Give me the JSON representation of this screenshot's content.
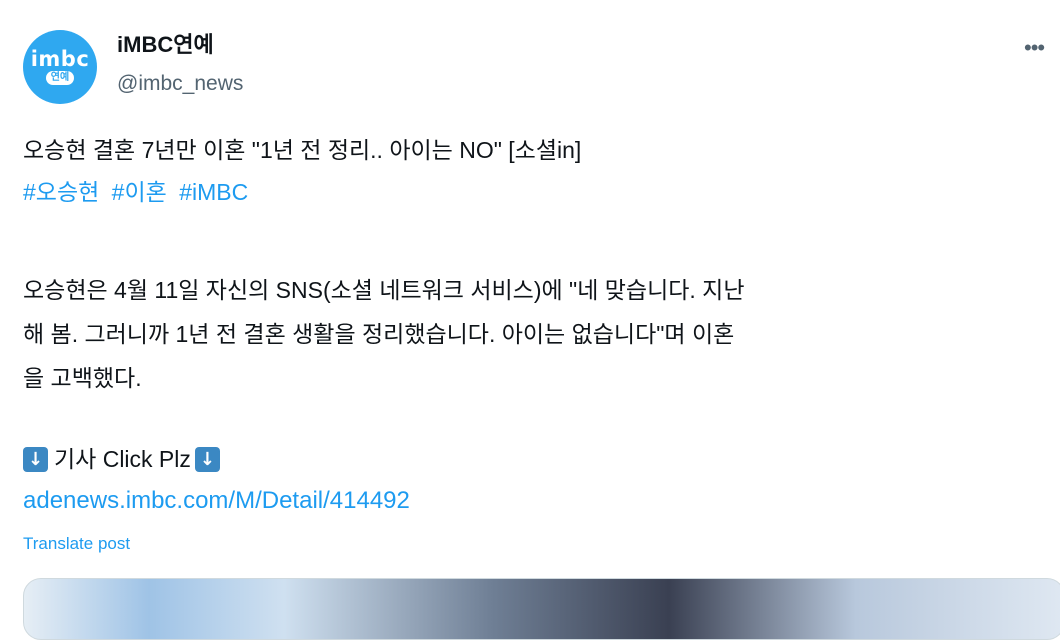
{
  "author": {
    "avatar_text_top": "imbc",
    "avatar_text_bottom": "연예",
    "display_name": "iMBC연예",
    "handle": "@imbc_news"
  },
  "more_icon": "more-horizontal-icon",
  "post": {
    "headline": "오승현 결혼 7년만 이혼 \"1년 전 정리.. 아이는 NO\" [소셜in]",
    "hashtags": [
      "#오승현",
      "#이혼",
      "#iMBC"
    ],
    "paragraph_lines": [
      "오승현은 4월 11일 자신의 SNS(소셜 네트워크 서비스)에 \"네 맞습니다. 지난",
      "해 봄. 그러니까 1년 전 결혼 생활을 정리했습니다. 아이는 없습니다\"며 이혼",
      "을 고백했다."
    ],
    "click_text": "기사 Click Plz",
    "arrow_icon": "down-arrow-emoji-icon",
    "link": "adenews.imbc.com/M/Detail/414492",
    "translate_label": "Translate post"
  },
  "colors": {
    "link": "#1d9bf0",
    "secondary_text": "#536471",
    "avatar_bg": "#2fa8f0",
    "arrow_emoji": "#3b88c3"
  }
}
